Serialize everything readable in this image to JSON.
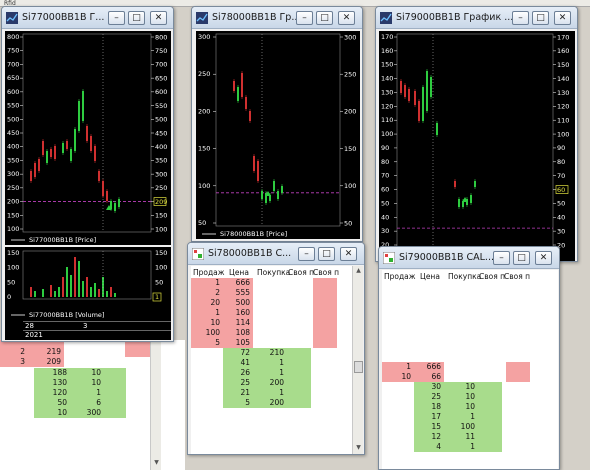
{
  "topstrip": {
    "text": "Rfid"
  },
  "window1": {
    "title": "Si77000BB1B Г...",
    "price_legend": "Si77000BB1B [Price]",
    "price_marker": "209",
    "volume_legend": "Si77000BB1B [Volume]",
    "volume_marker": "1",
    "axis_left": [
      "800",
      "750",
      "700",
      "650",
      "600",
      "550",
      "500",
      "450",
      "400",
      "350",
      "300",
      "250",
      "200",
      "150",
      "100"
    ],
    "axis_right": [
      "800",
      "750",
      "700",
      "650",
      "600",
      "550",
      "500",
      "450",
      "400",
      "350",
      "300",
      "250",
      "209",
      "150",
      "100"
    ],
    "vol_axis": [
      "150",
      "100",
      "50",
      "0"
    ],
    "foot_rows": [
      [
        "28",
        "3"
      ],
      [
        "2021",
        ""
      ]
    ]
  },
  "window2": {
    "title": "Si78000BB1B Гр...",
    "price_legend": "Si78000BB1B [Price]",
    "price_marker": "97",
    "axis_left": [
      "300",
      "250",
      "200",
      "150",
      "100",
      "50"
    ],
    "axis_right": [
      "300",
      "250",
      "200",
      "150",
      "100",
      "50"
    ]
  },
  "window3": {
    "title": "Si79000BB1B График ...",
    "price_legend": "Si79000BB1B [Price]",
    "price_marker": "60",
    "axis_left": [
      "170",
      "160",
      "150",
      "140",
      "130",
      "120",
      "110",
      "100",
      "90",
      "80",
      "70",
      "60",
      "50",
      "40",
      "30",
      "20"
    ],
    "axis_right": [
      "170",
      "160",
      "150",
      "140",
      "130",
      "120",
      "110",
      "100",
      "90",
      "80",
      "70",
      "60",
      "50",
      "40",
      "30",
      "20"
    ]
  },
  "window4": {
    "title": "Si78000BB1B C...",
    "headers": [
      "Продаж",
      "Цена",
      "Покупка",
      "Своя п",
      "Своя п"
    ],
    "sell_rows": [
      [
        "1",
        "666"
      ],
      [
        "2",
        "555"
      ],
      [
        "20",
        "500"
      ],
      [
        "1",
        "160"
      ],
      [
        "10",
        "114"
      ],
      [
        "100",
        "108"
      ],
      [
        "5",
        "105"
      ]
    ],
    "buy_rows": [
      [
        "72",
        "210"
      ],
      [
        "41",
        "1"
      ],
      [
        "26",
        "1"
      ],
      [
        "25",
        "200"
      ],
      [
        "21",
        "1"
      ],
      [
        "5",
        "200"
      ]
    ]
  },
  "window5": {
    "title": "Si79000BB1B CAL...",
    "headers": [
      "Продаж",
      "Цена",
      "Покупка",
      "Своя п",
      "Своя п"
    ],
    "sell_rows": [
      [
        "1",
        "666"
      ],
      [
        "10",
        "66"
      ]
    ],
    "buy_rows": [
      [
        "30",
        "10"
      ],
      [
        "25",
        "10"
      ],
      [
        "18",
        "10"
      ],
      [
        "17",
        "1"
      ],
      [
        "15",
        "100"
      ],
      [
        "12",
        "11"
      ],
      [
        "4",
        "1"
      ]
    ]
  },
  "background_table": {
    "sell_rows": [
      [
        "2",
        "219"
      ],
      [
        "3",
        "209"
      ]
    ],
    "buy_rows": [
      [
        "188",
        "10"
      ],
      [
        "130",
        "10"
      ],
      [
        "120",
        "1"
      ],
      [
        "50",
        "6"
      ],
      [
        "10",
        "300"
      ]
    ]
  },
  "colors": {
    "sell": "#f4a2a2",
    "buy": "#a8dc8c",
    "up": "#2ecc40",
    "down": "#d03030",
    "marker": "#e0e040"
  }
}
